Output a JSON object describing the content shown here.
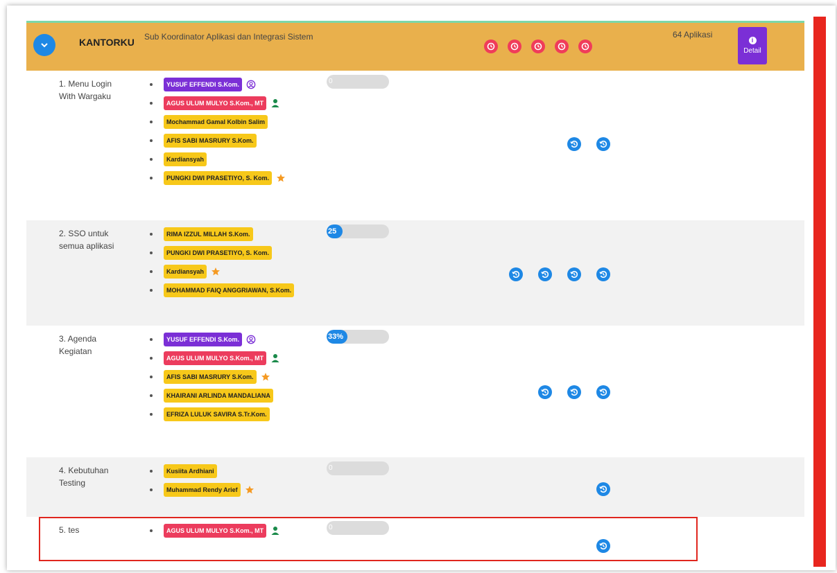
{
  "header": {
    "unit_code": "KANTORKU",
    "unit_name": "Sub Koordinator Aplikasi dan Integrasi Sistem",
    "app_count": "64 Aplikasi",
    "detail_label": "Detail",
    "status_icon_count": 5,
    "colors": {
      "header_bg": "#e9b04c",
      "detail_bg": "#7b2fd6",
      "status_red": "#f03c5a",
      "accent_blue": "#1e88e5"
    }
  },
  "rows": [
    {
      "name": "1. Menu Login With Wargaku",
      "progress": 0,
      "progress_label": "0",
      "members": [
        {
          "name": "YUSUF EFFENDI S.Kom.",
          "color": "purple",
          "role_icon": "user-circle-icon"
        },
        {
          "name": "AGUS ULUM MULYO S.Kom., MT",
          "color": "pink",
          "role_icon": "user-icon"
        },
        {
          "name": "Mochammad Gamal Kolbin Salim",
          "color": "yellow",
          "role_icon": ""
        },
        {
          "name": "AFIS SABI MASRURY S.Kom.",
          "color": "yellow",
          "role_icon": ""
        },
        {
          "name": "Kardiansyah",
          "color": "yellow",
          "role_icon": ""
        },
        {
          "name": "PUNGKI DWI PRASETIYO, S. Kom.",
          "color": "yellow",
          "role_icon": "star-icon"
        }
      ],
      "history_count": 2
    },
    {
      "name": "2. SSO untuk semua aplikasi",
      "progress": 25,
      "progress_label": "25",
      "members": [
        {
          "name": "RIMA IZZUL MILLAH S.Kom.",
          "color": "yellow",
          "role_icon": ""
        },
        {
          "name": "PUNGKI DWI PRASETIYO, S. Kom.",
          "color": "yellow",
          "role_icon": ""
        },
        {
          "name": "Kardiansyah",
          "color": "yellow",
          "role_icon": "star-icon"
        },
        {
          "name": "MOHAMMAD FAIQ ANGGRIAWAN, S.Kom.",
          "color": "yellow",
          "role_icon": ""
        }
      ],
      "history_count": 4
    },
    {
      "name": "3. Agenda Kegiatan",
      "progress": 33,
      "progress_label": "33%",
      "members": [
        {
          "name": "YUSUF EFFENDI S.Kom.",
          "color": "purple",
          "role_icon": "user-circle-icon"
        },
        {
          "name": "AGUS ULUM MULYO S.Kom., MT",
          "color": "pink",
          "role_icon": "user-icon"
        },
        {
          "name": "AFIS SABI MASRURY S.Kom.",
          "color": "yellow",
          "role_icon": "star-icon"
        },
        {
          "name": "KHAIRANI ARLINDA MANDALIANA",
          "color": "yellow",
          "role_icon": ""
        },
        {
          "name": "EFRIZA LULUK SAVIRA S.Tr.Kom.",
          "color": "yellow",
          "role_icon": ""
        }
      ],
      "history_count": 3
    },
    {
      "name": "4. Kebutuhan Testing",
      "progress": 0,
      "progress_label": "0",
      "members": [
        {
          "name": "Kusiita Ardhiani",
          "color": "yellow",
          "role_icon": ""
        },
        {
          "name": "Muhammad Rendy Arief",
          "color": "yellow",
          "role_icon": "star-icon"
        }
      ],
      "history_count": 1
    },
    {
      "name": "5. tes",
      "progress": 0,
      "progress_label": "0",
      "members": [
        {
          "name": "AGUS ULUM MULYO S.Kom., MT",
          "color": "pink",
          "role_icon": "user-icon"
        }
      ],
      "history_count": 1
    }
  ]
}
